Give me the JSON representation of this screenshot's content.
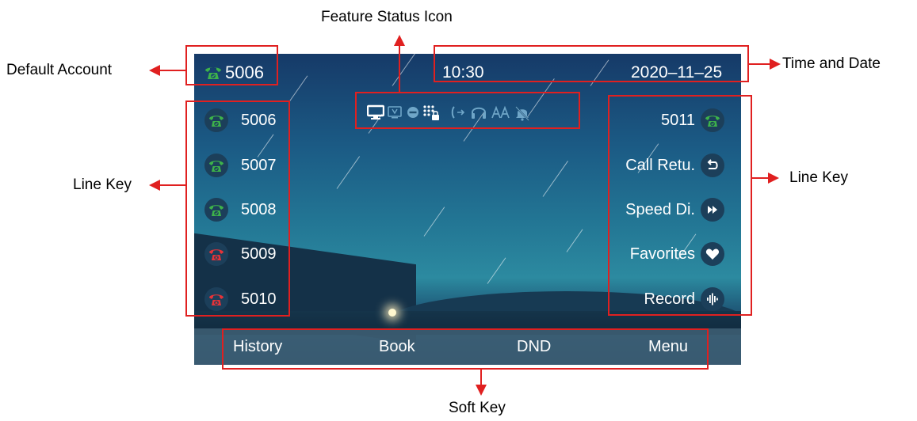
{
  "colors": {
    "annotation_red": "#e02020",
    "line_registered": "#3db24a",
    "line_unregistered": "#e63338",
    "softkey_bar": "#406076"
  },
  "annotations": {
    "feature_status": "Feature Status Icon",
    "default_account": "Default Account",
    "time_and_date": "Time and Date",
    "line_key_left": "Line Key",
    "line_key_right": "Line Key",
    "soft_key": "Soft Key"
  },
  "status_bar": {
    "account": "5006",
    "time": "10:30",
    "date": "2020–11–25",
    "feature_icons": [
      "monitor-icon",
      "video-icon",
      "dnd-icon",
      "keypad-lock-icon",
      "forward-icon",
      "headset-icon",
      "auto-answer-icon",
      "muted-ring-icon"
    ]
  },
  "left_lines": [
    {
      "label": "5006",
      "state": "registered",
      "icon": "phone-check-icon"
    },
    {
      "label": "5007",
      "state": "registered",
      "icon": "phone-check-icon"
    },
    {
      "label": "5008",
      "state": "registered",
      "icon": "phone-check-icon"
    },
    {
      "label": "5009",
      "state": "unregistered",
      "icon": "phone-x-icon"
    },
    {
      "label": "5010",
      "state": "unregistered",
      "icon": "phone-x-icon"
    }
  ],
  "right_lines": [
    {
      "label": "5011",
      "icon": "phone-check-icon"
    },
    {
      "label": "Call Retu.",
      "icon": "return-icon"
    },
    {
      "label": "Speed Di.",
      "icon": "fast-forward-icon"
    },
    {
      "label": "Favorites",
      "icon": "heart-icon"
    },
    {
      "label": "Record",
      "icon": "voice-wave-icon"
    }
  ],
  "softkeys": [
    "History",
    "Book",
    "DND",
    "Menu"
  ]
}
